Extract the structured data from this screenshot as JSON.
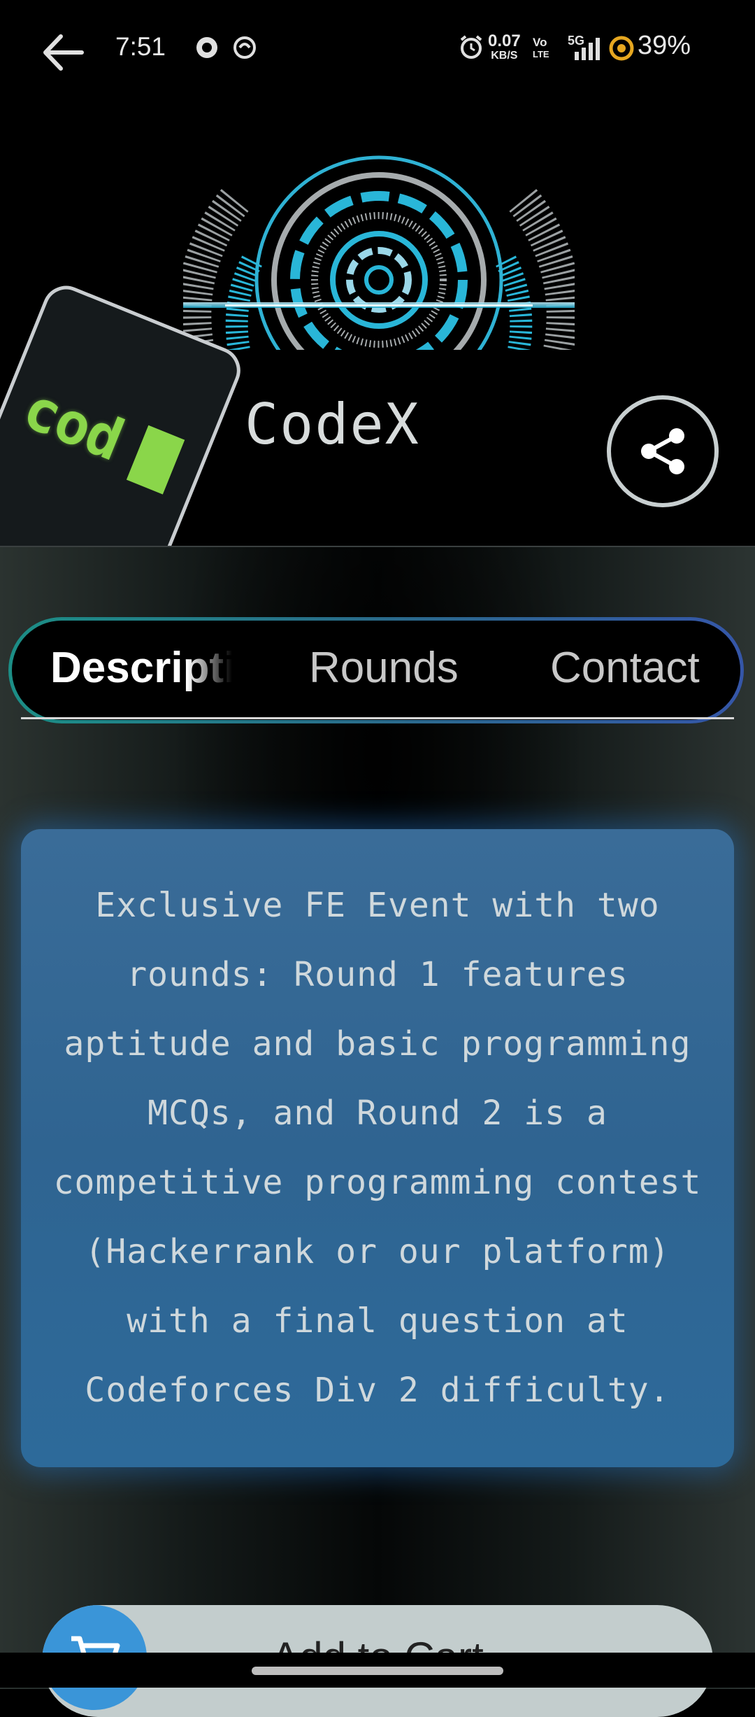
{
  "status_bar": {
    "time": "7:51",
    "net_speed_value": "0.07",
    "net_speed_unit": "KB/S",
    "volte_top": "Vo",
    "volte_bottom": "LTE",
    "network": "5G",
    "battery": "39%"
  },
  "icons": {
    "back": "arrow-left-icon",
    "share": "share-icon",
    "cart": "cart-icon"
  },
  "event": {
    "logo_text": "cod",
    "title": "CodeX"
  },
  "tabs": [
    {
      "label": "Description",
      "active": true
    },
    {
      "label": "Rounds",
      "active": false
    },
    {
      "label": "Contact",
      "active": false
    }
  ],
  "description": "Exclusive FE Event with two rounds: Round 1 features aptitude and basic programming MCQs, and Round 2 is a competitive programming contest (Hackerrank or our platform) with a final question at Codeforces Div 2 difficulty.",
  "cart": {
    "label": "Add to Cart"
  },
  "colors": {
    "card_blue": "#2f6491",
    "tab_border_start": "#1c8e86",
    "tab_border_end": "#3556a8",
    "logo_green": "#8ad64a",
    "cart_button_bg": "#c3cdcd",
    "cart_icon_bg": "#3a95d8"
  }
}
